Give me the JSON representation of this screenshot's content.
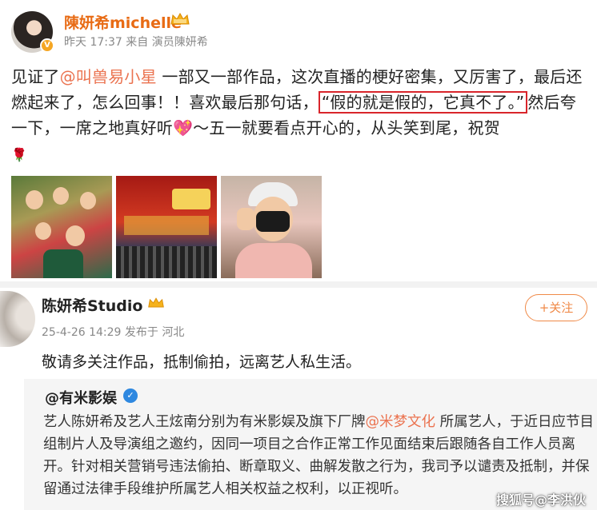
{
  "post1": {
    "user_name": "陳妍希michelle",
    "meta": "昨天 17:37 来自 演员陳妍希",
    "text_before_mention": "见证了",
    "mention": "@叫兽易小星",
    "text_after_mention": " 一部又一部作品，这次直播的梗好密集，又厉害了，最后还燃起来了，怎么回事！！喜欢最后那句话，",
    "highlight_quote": "“假的就是假的，它真不了。”",
    "text_end": "然后夸一下，一席之地真好听",
    "text_end2": "～五一就要看点开心的，从头笑到尾，祝贺",
    "heart_emoji": "💖",
    "rose_emoji": "🌹",
    "thumbnails": [
      "poster-photo",
      "stage-event-photo",
      "selfie-photo"
    ]
  },
  "post2": {
    "user_name": "陈妍希Studio",
    "follow_label": "+关注",
    "meta": "25-4-26 14:29 发布于 河北",
    "text": "敬请多关注作品，抵制偷拍，远离艺人私生活。",
    "quote": {
      "author": "@有米影娱",
      "text_1": "艺人陈妍希及艺人王炫南分别为有米影娱及旗下厂牌",
      "mention": "@米梦文化",
      "text_2": " 所属艺人，于近日应节目组制片人及导演组之邀约，因同一项目之合作正常工作见面结束后跟随各自工作人员离开。针对相关营销号违法偷拍、断章取义、曲解发散之行为，我司予以谴责及抵制，并保留通过法律手段维护所属艺人相关权益之权利，以正视听。"
    }
  },
  "watermark": "搜狐号@李洪伙",
  "colors": {
    "name_orange": "#e86b14",
    "mention": "#eb7350",
    "highlight_box": "#d9252b",
    "verified_blue": "#2e88e0",
    "follow_orange": "#f08a48"
  }
}
